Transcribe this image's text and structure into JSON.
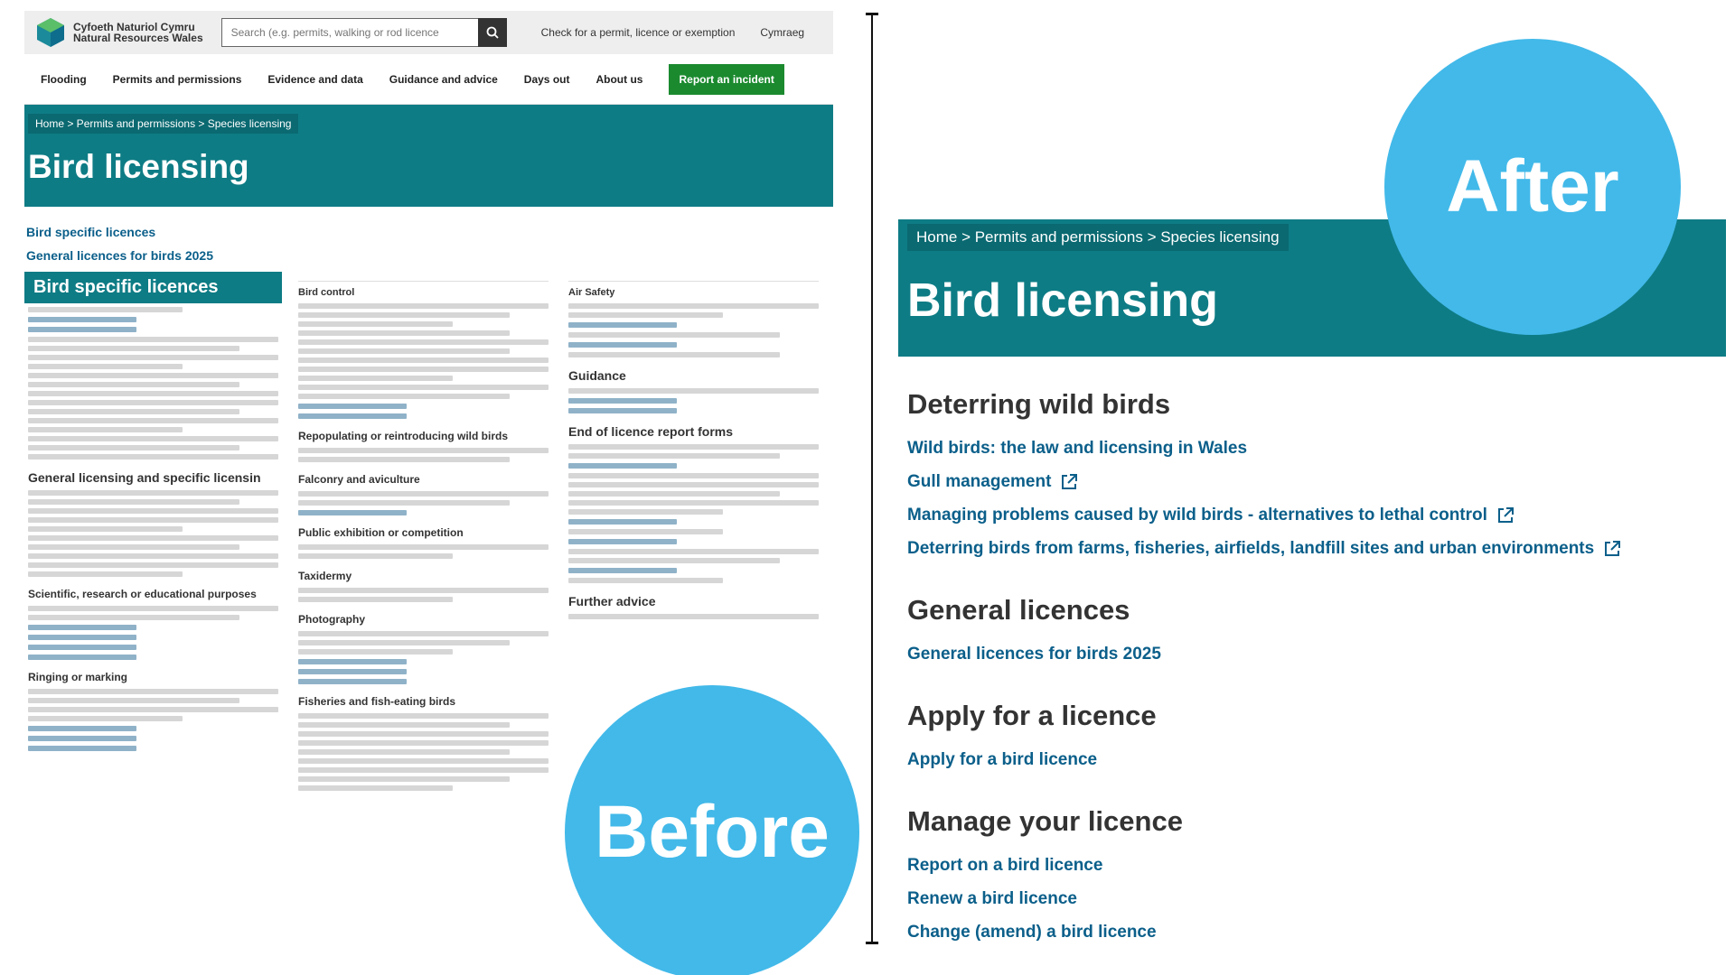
{
  "before": {
    "logo": {
      "line1": "Cyfoeth Naturiol Cymru",
      "line2": "Natural Resources Wales"
    },
    "search": {
      "placeholder": "Search (e.g. permits, walking or rod licence"
    },
    "topbar_links": [
      "Check for a permit, licence or exemption",
      "Cymraeg"
    ],
    "nav": [
      "Flooding",
      "Permits and permissions",
      "Evidence and data",
      "Guidance and advice",
      "Days out",
      "About us"
    ],
    "nav_cta": "Report an incident",
    "breadcrumb": "Home > Permits and permissions > Species licensing",
    "title": "Bird licensing",
    "quick_links": [
      "Bird specific licences",
      "General licences for birds 2025"
    ],
    "col1": {
      "box_heading": "Bird specific licences",
      "subheads": [
        "General licensing and specific licensin",
        "Scientific, research or educational purposes",
        "Ringing or marking"
      ]
    },
    "col2": {
      "subheads": [
        "Bird control",
        "Repopulating or reintroducing wild birds",
        "Falconry and aviculture",
        "Public exhibition or competition",
        "Taxidermy",
        "Photography",
        "Fisheries and fish-eating birds"
      ]
    },
    "col3": {
      "subheads": [
        "Air Safety",
        "Guidance",
        "End of licence report forms",
        "Further advice"
      ]
    }
  },
  "after": {
    "breadcrumb": "Home > Permits and permissions > Species licensing",
    "title": "Bird licensing",
    "sections": [
      {
        "heading": "Deterring wild birds",
        "links": [
          {
            "label": "Wild birds: the law and licensing in Wales",
            "external": false
          },
          {
            "label": "Gull management",
            "external": true
          },
          {
            "label": "Managing problems caused by wild birds - alternatives to lethal control",
            "external": true
          },
          {
            "label": "Deterring birds from farms, fisheries, airfields, landfill sites and urban environments",
            "external": true
          }
        ]
      },
      {
        "heading": "General licences",
        "links": [
          {
            "label": "General licences for birds 2025",
            "external": false
          }
        ]
      },
      {
        "heading": "Apply for a licence",
        "links": [
          {
            "label": "Apply for a bird licence",
            "external": false
          }
        ]
      },
      {
        "heading": "Manage your licence",
        "links": [
          {
            "label": "Report on a bird licence",
            "external": false
          },
          {
            "label": "Renew a bird licence",
            "external": false
          },
          {
            "label": "Change (amend) a bird licence",
            "external": false
          }
        ]
      }
    ]
  },
  "badges": {
    "after": "After",
    "before": "Before"
  },
  "colors": {
    "teal": "#0e7c85",
    "badge": "#42b9e9",
    "link": "#0b5f8a",
    "cta": "#1b8a2f"
  }
}
